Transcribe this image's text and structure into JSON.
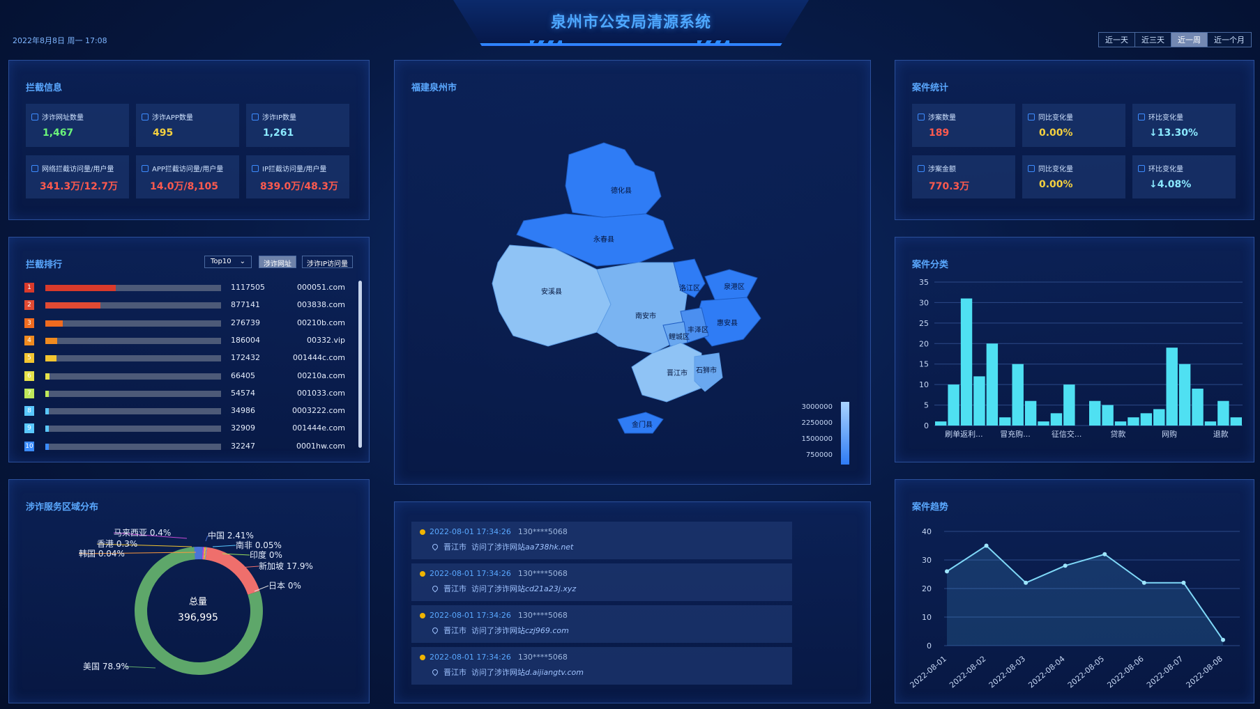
{
  "header": {
    "title": "泉州市公安局清源系统",
    "datetime": "2022年8月8日 周一 17:08",
    "ranges": [
      "近一天",
      "近三天",
      "近一周",
      "近一个月"
    ],
    "active_range": "近一周"
  },
  "intercept": {
    "title": "拦截信息",
    "cards": [
      {
        "label": "涉诈网址数量",
        "value": "1,467",
        "color": "#6af37a"
      },
      {
        "label": "涉诈APP数量",
        "value": "495",
        "color": "#f4d03f"
      },
      {
        "label": "涉诈IP数量",
        "value": "1,261",
        "color": "#8be9ff"
      },
      {
        "label": "网络拦截访问量/用户量",
        "value": "341.3万/12.7万",
        "color": "#ff5a4e"
      },
      {
        "label": "APP拦截访问量/用户量",
        "value": "14.0万/8,105",
        "color": "#ff5a4e"
      },
      {
        "label": "IP拦截访问量/用户量",
        "value": "839.0万/48.3万",
        "color": "#ff5a4e"
      }
    ]
  },
  "ranking": {
    "title": "拦截排行",
    "select": "Top10",
    "tabs": [
      "涉诈网址",
      "涉诈IP访问量"
    ],
    "rows": [
      {
        "rank": "1",
        "value": 1117505,
        "label": "1117505",
        "domain": "000051.com",
        "color": "#d93a2b"
      },
      {
        "rank": "2",
        "value": 877141,
        "label": "877141",
        "domain": "003838.com",
        "color": "#e14a33"
      },
      {
        "rank": "3",
        "value": 276739,
        "label": "276739",
        "domain": "00210b.com",
        "color": "#f06b1f"
      },
      {
        "rank": "4",
        "value": 186004,
        "label": "186004",
        "domain": "00332.vip",
        "color": "#f08a1f"
      },
      {
        "rank": "5",
        "value": 172432,
        "label": "172432",
        "domain": "001444c.com",
        "color": "#f3c531"
      },
      {
        "rank": "6",
        "value": 66405,
        "label": "66405",
        "domain": "00210a.com",
        "color": "#e6e24a"
      },
      {
        "rank": "7",
        "value": 54574,
        "label": "54574",
        "domain": "001033.com",
        "color": "#bfe85a"
      },
      {
        "rank": "8",
        "value": 34986,
        "label": "34986",
        "domain": "0003222.com",
        "color": "#5ac8ff"
      },
      {
        "rank": "9",
        "value": 32909,
        "label": "32909",
        "domain": "001444e.com",
        "color": "#5ac8ff"
      },
      {
        "rank": "10",
        "value": 32247,
        "label": "32247",
        "domain": "0001hw.com",
        "color": "#3b8cff"
      }
    ]
  },
  "region": {
    "title": "涉诈服务区域分布",
    "total_label": "总量",
    "total_value": "396,995",
    "slices": [
      {
        "name": "美国",
        "value": 78.9,
        "label": "美国 78.9%",
        "color": "#5ea76a"
      },
      {
        "name": "新加坡",
        "value": 17.9,
        "label": "新加坡 17.9%",
        "color": "#ef6f6c"
      },
      {
        "name": "中国",
        "value": 2.41,
        "label": "中国 2.41%",
        "color": "#4a74d8"
      },
      {
        "name": "马来西亚",
        "value": 0.4,
        "label": "马来西亚 0.4%",
        "color": "#c84bd6"
      },
      {
        "name": "香港",
        "value": 0.3,
        "label": "香港 0.3%",
        "color": "#f3c531"
      },
      {
        "name": "南非",
        "value": 0.05,
        "label": "南非 0.05%",
        "color": "#5ac8ff"
      },
      {
        "name": "韩国",
        "value": 0.04,
        "label": "韩国 0.04%",
        "color": "#ff9a3c"
      },
      {
        "name": "印度",
        "value": 0,
        "label": "印度 0%",
        "color": "#9be15d"
      },
      {
        "name": "日本",
        "value": 0,
        "label": "日本 0%",
        "color": "#e0e0e0"
      }
    ]
  },
  "map": {
    "title": "福建泉州市",
    "districts": [
      "德化县",
      "永春县",
      "安溪县",
      "南安市",
      "鲤城区",
      "洛江区",
      "泉港区",
      "惠安县",
      "丰泽区",
      "晋江市",
      "石狮市",
      "金门县"
    ],
    "legend": [
      "3000000",
      "2250000",
      "1500000",
      "750000"
    ]
  },
  "logs": [
    {
      "time": "2022-08-01 17:34:26",
      "phone": "130****5068",
      "city": "晋江市",
      "action": "访问了涉诈网站",
      "url": "aa738hk.net"
    },
    {
      "time": "2022-08-01 17:34:26",
      "phone": "130****5068",
      "city": "晋江市",
      "action": "访问了涉诈网站",
      "url": "cd21a23j.xyz"
    },
    {
      "time": "2022-08-01 17:34:26",
      "phone": "130****5068",
      "city": "晋江市",
      "action": "访问了涉诈网站",
      "url": "czj969.com"
    },
    {
      "time": "2022-08-01 17:34:26",
      "phone": "130****5068",
      "city": "晋江市",
      "action": "访问了涉诈网站",
      "url": "d.aijiangtv.com"
    }
  ],
  "case_stats": {
    "title": "案件统计",
    "cards": [
      {
        "label": "涉案数量",
        "value": "189",
        "color": "#ff5a4e"
      },
      {
        "label": "同比变化量",
        "value": "0.00%",
        "color": "#f4d03f"
      },
      {
        "label": "环比变化量",
        "value": "↓13.30%",
        "color": "#8be9ff"
      },
      {
        "label": "涉案金额",
        "value": "770.3万",
        "color": "#ff5a4e"
      },
      {
        "label": "同比变化量",
        "value": "0.00%",
        "color": "#f4d03f"
      },
      {
        "label": "环比变化量",
        "value": "↓4.08%",
        "color": "#8be9ff"
      }
    ]
  },
  "category_chart": {
    "title": "案件分类"
  },
  "trend_chart": {
    "title": "案件趋势"
  },
  "chart_data": [
    {
      "type": "bar",
      "title": "案件分类",
      "ylim": [
        0,
        35
      ],
      "yticks": [
        0,
        5,
        10,
        15,
        20,
        25,
        30,
        35
      ],
      "grid": true,
      "x_labels": [
        "刷单返利...",
        "冒充购...",
        "征信交...",
        "贷款",
        "网购",
        "退款"
      ],
      "values": [
        1,
        10,
        31,
        12,
        20,
        2,
        15,
        6,
        1,
        3,
        10,
        0,
        6,
        5,
        1,
        2,
        3,
        4,
        19,
        15,
        9,
        1,
        6,
        2
      ]
    },
    {
      "type": "line",
      "title": "案件趋势",
      "ylim": [
        0,
        40
      ],
      "yticks": [
        0,
        10,
        20,
        30,
        40
      ],
      "grid": true,
      "x": [
        "2022-08-01",
        "2022-08-02",
        "2022-08-03",
        "2022-08-04",
        "2022-08-05",
        "2022-08-06",
        "2022-08-07",
        "2022-08-08"
      ],
      "values": [
        26,
        35,
        22,
        28,
        32,
        22,
        22,
        2
      ]
    }
  ]
}
